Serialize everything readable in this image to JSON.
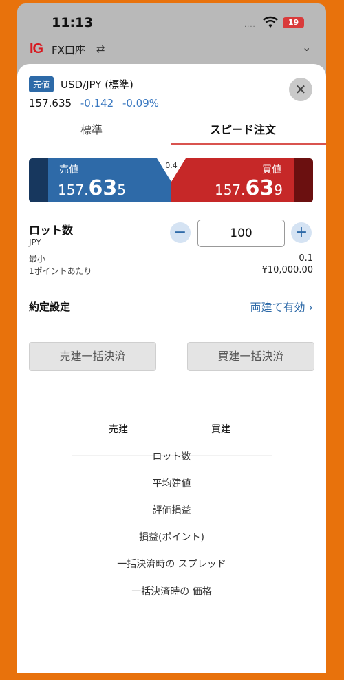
{
  "status": {
    "time": "11:13",
    "signal": "....",
    "battery": "19"
  },
  "app_bar": {
    "logo": "IG",
    "account": "FX口座",
    "switch_icon": "switch-icon",
    "chevron": "chevron-down-icon"
  },
  "instrument": {
    "badge": "売値",
    "name": "USD/JPY (標準)",
    "price": "157.635",
    "change": "-0.142",
    "change_pct": "-0.09%"
  },
  "tabs": [
    {
      "label": "標準",
      "active": false
    },
    {
      "label": "スピード注文",
      "active": true
    }
  ],
  "quote": {
    "spread": "0.4",
    "sell": {
      "label": "売値",
      "prefix": "157.",
      "big": "63",
      "suffix": "5"
    },
    "buy": {
      "label": "買値",
      "prefix": "157.",
      "big": "63",
      "suffix": "9"
    }
  },
  "lot": {
    "title": "ロット数",
    "unit": "JPY",
    "value": "100",
    "min_label": "最小",
    "min_value": "0.1",
    "per_point_label": "1ポイントあたり",
    "per_point_value": "¥10,000.00"
  },
  "fill_setting": {
    "label": "約定設定",
    "value": "両建て有効",
    "chevron": "chevron-right-icon"
  },
  "bulk": {
    "sell": "売建一括決済",
    "buy": "買建一括決済"
  },
  "positions": {
    "col_sell": "売建",
    "col_buy": "買建",
    "rows": [
      "ロット数",
      "平均建値",
      "評価損益",
      "損益(ポイント)",
      "一括決済時の スプレッド",
      "一括決済時の 価格"
    ]
  },
  "colors": {
    "accent": "#2e6aa8",
    "sell": "#2e6aa8",
    "buy": "#c62828",
    "frame": "#e8720c"
  }
}
